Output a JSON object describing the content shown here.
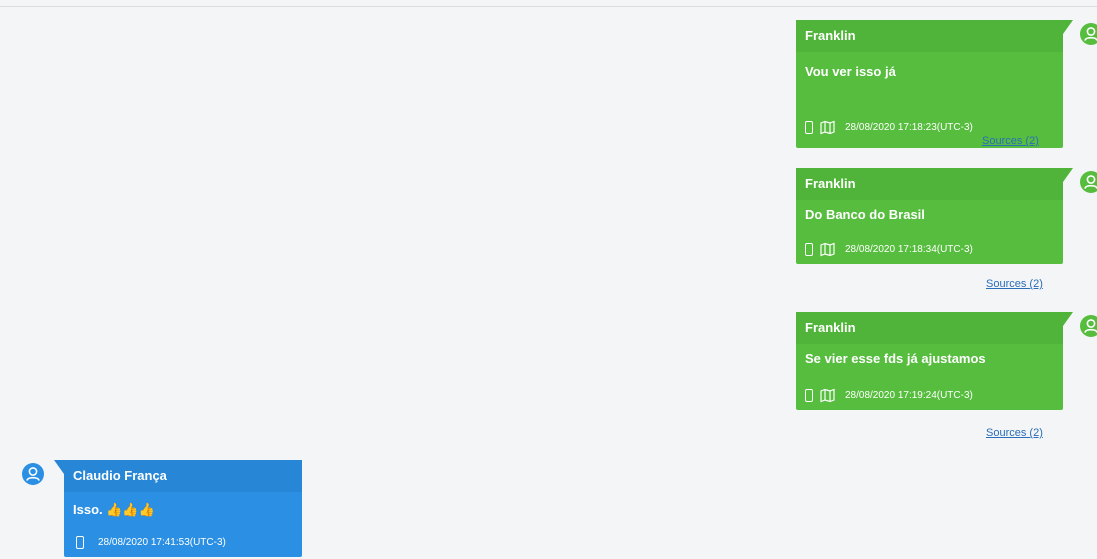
{
  "colors": {
    "outgoing_bubble": "#57bd3f",
    "incoming_bubble": "#2b8fe3",
    "link": "#2a6db8",
    "background": "#f4f5f7"
  },
  "messages": [
    {
      "direction": "outgoing",
      "sender": "Franklin",
      "text": "Vou ver isso já",
      "timestamp": "28/08/2020 17:18:23(UTC-3)",
      "icons": [
        "phone-icon",
        "map-icon"
      ],
      "sources_label": "Sources (2)"
    },
    {
      "direction": "outgoing",
      "sender": "Franklin",
      "text": "Do Banco do Brasil",
      "timestamp": "28/08/2020 17:18:34(UTC-3)",
      "icons": [
        "phone-icon",
        "map-icon"
      ],
      "sources_label": "Sources (2)"
    },
    {
      "direction": "outgoing",
      "sender": "Franklin",
      "text": "Se vier esse fds já ajustamos",
      "timestamp": "28/08/2020 17:19:24(UTC-3)",
      "icons": [
        "phone-icon",
        "map-icon"
      ],
      "sources_label": "Sources (2)"
    },
    {
      "direction": "incoming",
      "sender": "Claudio França",
      "text": "Isso. 👍👍👍",
      "timestamp": "28/08/2020 17:41:53(UTC-3)",
      "icons": [
        "phone-icon"
      ]
    }
  ]
}
